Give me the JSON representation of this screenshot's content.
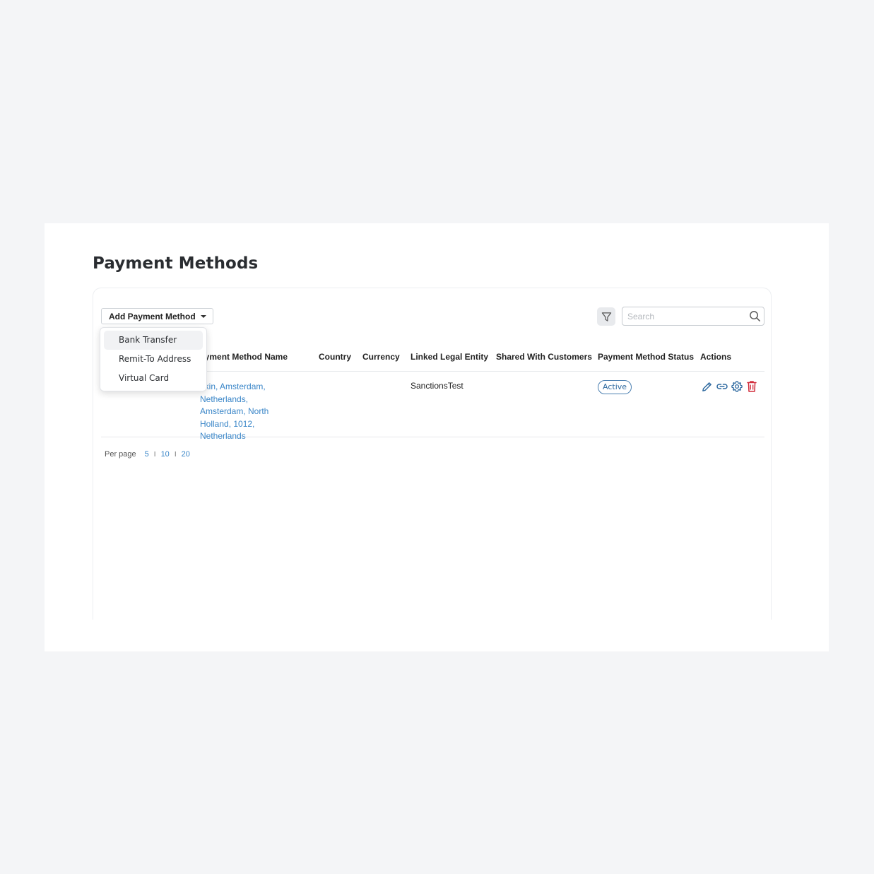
{
  "page": {
    "title": "Payment Methods"
  },
  "toolbar": {
    "add_button_label": "Add Payment Method",
    "search_placeholder": "Search"
  },
  "dropdown": {
    "items": [
      {
        "label": "Bank Transfer",
        "highlighted": true
      },
      {
        "label": "Remit-To Address",
        "highlighted": false
      },
      {
        "label": "Virtual Card",
        "highlighted": false
      }
    ]
  },
  "table": {
    "columns": [
      "ayment Method Name",
      "Country",
      "Currency",
      "Linked Legal Entity",
      "Shared With Customers",
      "Payment Method Status",
      "Actions"
    ],
    "rows": [
      {
        "name": "okin, Amsterdam, Netherlands, Amsterdam, North Holland, 1012, Netherlands",
        "country": "",
        "currency": "",
        "linked_legal_entity": "SanctionsTest",
        "shared_with_customers": "",
        "status": "Active"
      }
    ]
  },
  "pagination": {
    "label": "Per page",
    "options": [
      "5",
      "10",
      "20"
    ],
    "separator": "I"
  },
  "colors": {
    "link": "#3a86c8",
    "status_border": "#4a7fb0",
    "delete": "#d12b3a",
    "background": "#f4f5f7"
  },
  "icons": [
    "chevron-down-icon",
    "filter-icon",
    "search-icon",
    "edit-icon",
    "link-icon",
    "settings-icon",
    "delete-icon"
  ]
}
